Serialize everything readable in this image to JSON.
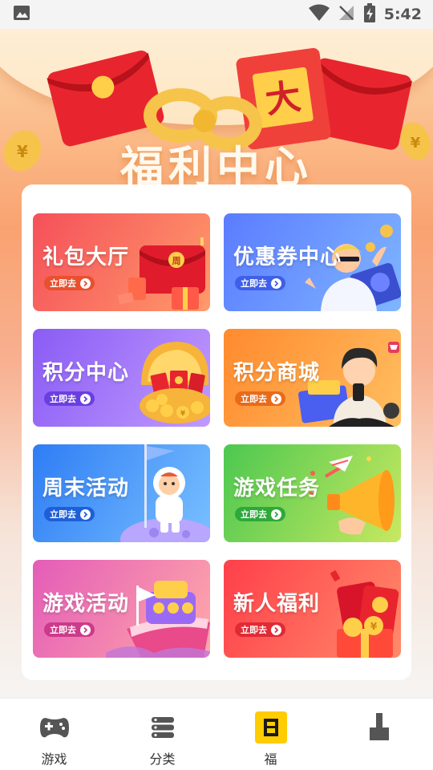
{
  "status_bar": {
    "time": "5:42",
    "icons": [
      "image-icon",
      "wifi-icon",
      "no-signal-icon",
      "battery-charging-icon"
    ]
  },
  "hero": {
    "title": "福利中心",
    "coin_glyph": "¥",
    "envelope_glyph": "大"
  },
  "cards": [
    {
      "title": "礼包大厅",
      "button_label": "立即去",
      "art_glyph": "周",
      "colors": {
        "from": "#f5505a",
        "to": "#ff9a6a",
        "button": "#e8502e"
      }
    },
    {
      "title": "优惠券中心",
      "button_label": "立即去",
      "colors": {
        "from": "#5b7cff",
        "to": "#7fb5ff",
        "button": "#3f5fe8"
      }
    },
    {
      "title": "积分中心",
      "button_label": "立即去",
      "art_glyph": "¥",
      "colors": {
        "from": "#8a5cf5",
        "to": "#c09aff",
        "button": "#6a3fe0"
      }
    },
    {
      "title": "积分商城",
      "button_label": "立即去",
      "colors": {
        "from": "#ff8a2e",
        "to": "#ffbe60",
        "button": "#e86a1a"
      }
    },
    {
      "title": "周末活动",
      "button_label": "立即去",
      "colors": {
        "from": "#2e7df5",
        "to": "#79c0ff",
        "button": "#1e5fd8"
      }
    },
    {
      "title": "游戏任务",
      "button_label": "立即去",
      "colors": {
        "from": "#4cc850",
        "to": "#c8e860",
        "button": "#2ea83a"
      }
    },
    {
      "title": "游戏活动",
      "button_label": "立即去",
      "colors": {
        "from": "#e45cb8",
        "to": "#ffa9a9",
        "button": "#cc3a8a"
      }
    },
    {
      "title": "新人福利",
      "button_label": "立即去",
      "art_glyph": "¥",
      "colors": {
        "from": "#ff3f4a",
        "to": "#ff8a6a",
        "button": "#e02a34"
      }
    }
  ],
  "bottom_nav": [
    {
      "label": "游戏",
      "icon": "gamepad-icon",
      "active": false
    },
    {
      "label": "分类",
      "icon": "list-icon",
      "active": false
    },
    {
      "label": "福",
      "icon": "gift-box-icon",
      "active": true,
      "accent": "#ffcc00"
    },
    {
      "label": "",
      "icon": "profile-icon",
      "active": false
    }
  ]
}
